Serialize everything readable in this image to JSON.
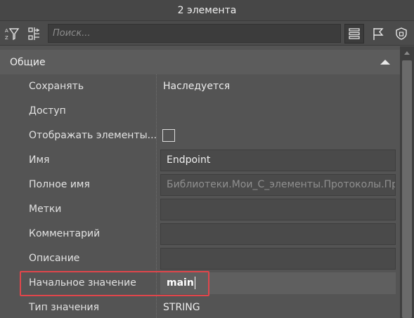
{
  "window": {
    "title": "2 элемента"
  },
  "toolbar": {
    "search_placeholder": "Поиск...",
    "buttons": [
      {
        "icon": "sort-filter-icon"
      },
      {
        "icon": "tree-icon"
      },
      {
        "icon": "list-icon",
        "active": true
      },
      {
        "icon": "flag-icon"
      },
      {
        "icon": "shield-icon"
      }
    ]
  },
  "section": {
    "title": "Общие",
    "expanded": true
  },
  "properties": [
    {
      "label": "Сохранять",
      "value": "Наследуется",
      "kind": "text"
    },
    {
      "label": "Доступ",
      "value": "",
      "kind": "empty"
    },
    {
      "label": "Отображать элементы...",
      "value": "",
      "kind": "checkbox",
      "checked": false
    },
    {
      "label": "Имя",
      "value": "Endpoint",
      "kind": "field"
    },
    {
      "label": "Полное имя",
      "value": "Библиотеки.Мои_С_элементы.Протоколы.Прото",
      "kind": "field-muted"
    },
    {
      "label": "Метки",
      "value": "",
      "kind": "field"
    },
    {
      "label": "Комментарий",
      "value": "",
      "kind": "field"
    },
    {
      "label": "Описание",
      "value": "",
      "kind": "field"
    },
    {
      "label": "Начальное значение",
      "value": "main",
      "kind": "field-active"
    },
    {
      "label": "Тип значения",
      "value": "STRING",
      "kind": "text"
    }
  ],
  "colors": {
    "highlight": "#e0464b",
    "background": "#545454"
  }
}
